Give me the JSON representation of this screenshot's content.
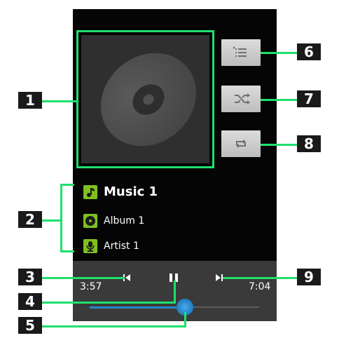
{
  "track": {
    "title": "Music 1",
    "album": "Album 1",
    "artist": "Artist 1"
  },
  "playback": {
    "elapsed": "3:57",
    "duration": "7:04",
    "progress_fraction": 0.56,
    "state": "playing"
  },
  "side_buttons": [
    {
      "name": "playlist",
      "icon": "list-icon"
    },
    {
      "name": "shuffle",
      "icon": "shuffle-icon"
    },
    {
      "name": "repeat",
      "icon": "repeat-icon"
    }
  ],
  "callouts": {
    "c1": "1",
    "c2": "2",
    "c3": "3",
    "c4": "4",
    "c5": "5",
    "c6": "6",
    "c7": "7",
    "c8": "8",
    "c9": "9"
  },
  "colors": {
    "highlight": "#1ee06c",
    "icon_badge": "#7ec11e",
    "progress": "#2b86c9"
  }
}
